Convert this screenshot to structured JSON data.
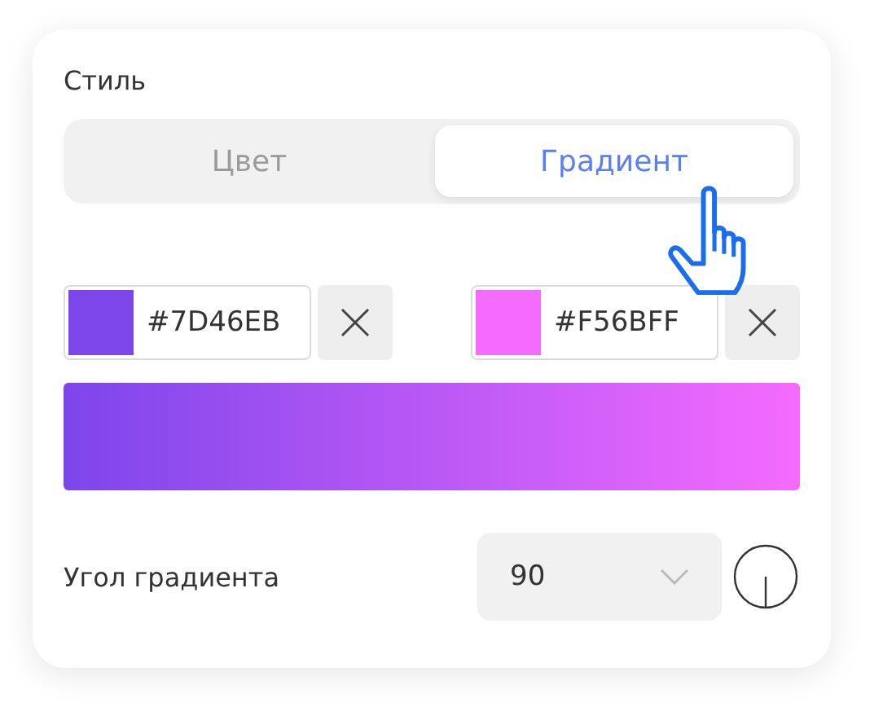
{
  "style_label": "Стиль",
  "tabs": [
    {
      "label": "Цвет",
      "selected": false
    },
    {
      "label": "Градиент",
      "selected": true
    }
  ],
  "stops": [
    {
      "value": "#7D46EB",
      "color": "#7d46eb"
    },
    {
      "value": "#F56BFF",
      "color": "#f56bff"
    }
  ],
  "angle": {
    "label": "Угол градиента",
    "value": "90"
  }
}
